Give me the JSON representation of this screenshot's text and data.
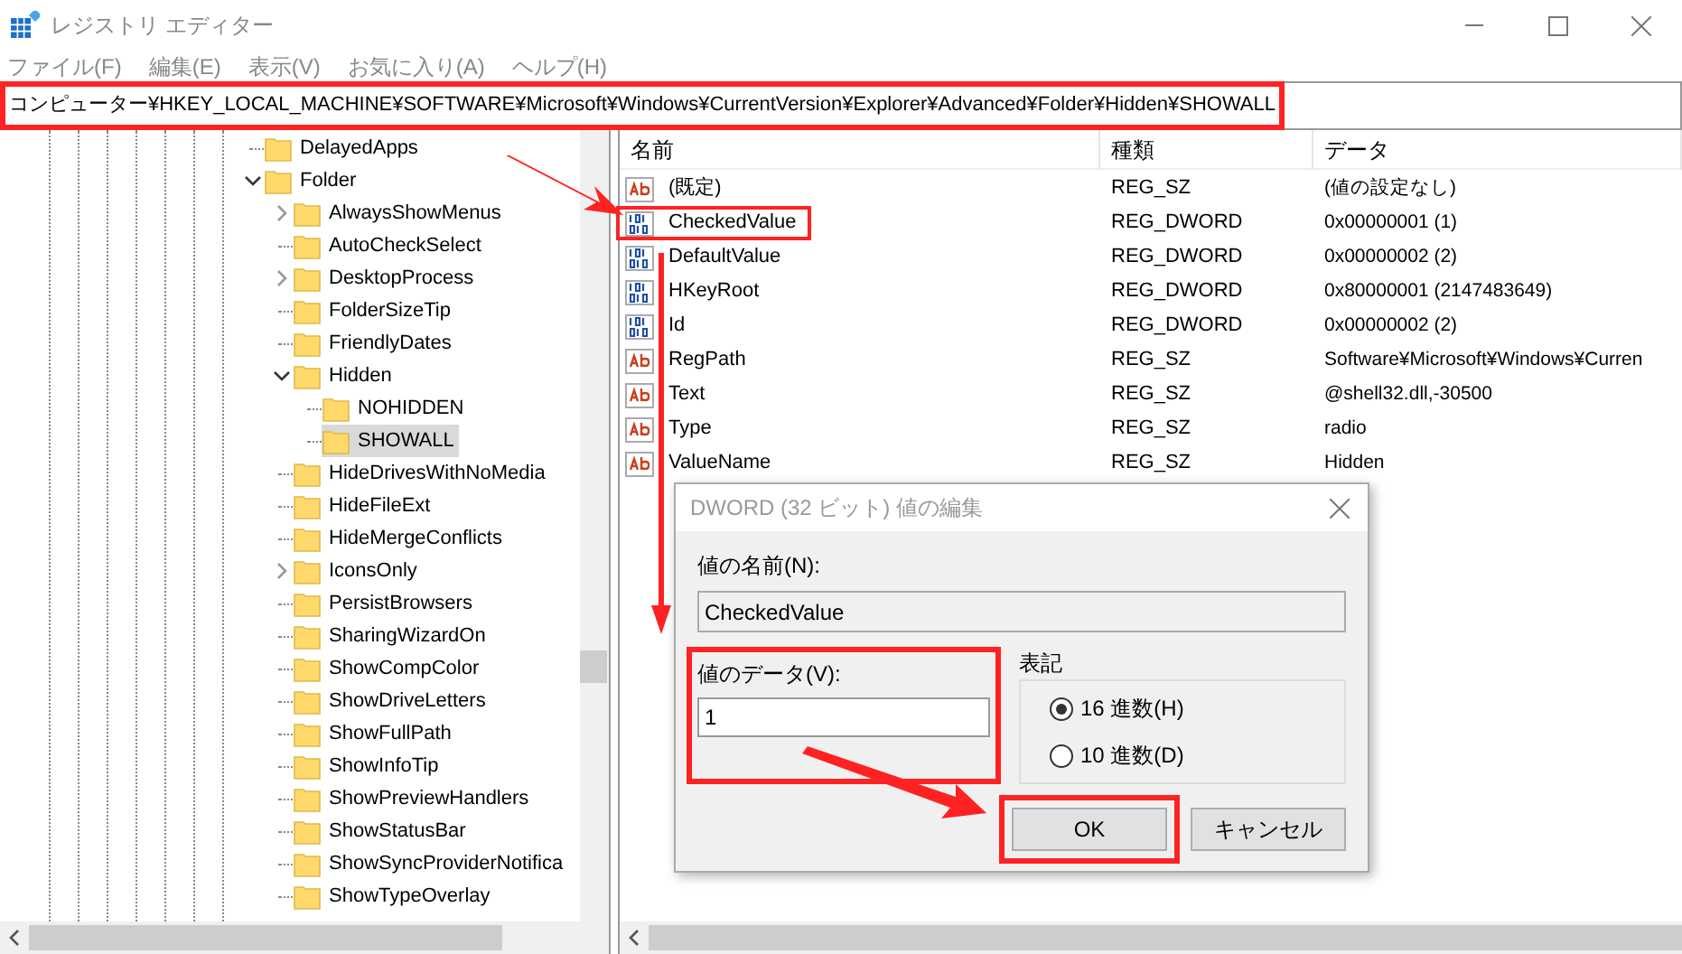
{
  "window": {
    "title": "レジストリ エディター"
  },
  "menu": [
    "ファイル(F)",
    "編集(E)",
    "表示(V)",
    "お気に入り(A)",
    "ヘルプ(H)"
  ],
  "address": "コンピューター¥HKEY_LOCAL_MACHINE¥SOFTWARE¥Microsoft¥Windows¥CurrentVersion¥Explorer¥Advanced¥Folder¥Hidden¥SHOWALL",
  "tree": [
    {
      "label": "DelayedApps",
      "kind": "leaf",
      "selected": false
    },
    {
      "label": "Folder",
      "kind": "node",
      "expanded": true,
      "selected": false,
      "children": [
        {
          "label": "AlwaysShowMenus",
          "kind": "node",
          "expanded": false,
          "selected": false
        },
        {
          "label": "AutoCheckSelect",
          "kind": "leaf",
          "selected": false
        },
        {
          "label": "DesktopProcess",
          "kind": "node",
          "expanded": false,
          "selected": false
        },
        {
          "label": "FolderSizeTip",
          "kind": "leaf",
          "selected": false
        },
        {
          "label": "FriendlyDates",
          "kind": "leaf",
          "selected": false
        },
        {
          "label": "Hidden",
          "kind": "node",
          "expanded": true,
          "selected": false,
          "children": [
            {
              "label": "NOHIDDEN",
              "kind": "leaf",
              "selected": false
            },
            {
              "label": "SHOWALL",
              "kind": "leaf",
              "selected": true
            }
          ]
        },
        {
          "label": "HideDrivesWithNoMedia",
          "kind": "leaf",
          "selected": false
        },
        {
          "label": "HideFileExt",
          "kind": "leaf",
          "selected": false
        },
        {
          "label": "HideMergeConflicts",
          "kind": "leaf",
          "selected": false
        },
        {
          "label": "IconsOnly",
          "kind": "node",
          "expanded": false,
          "selected": false
        },
        {
          "label": "PersistBrowsers",
          "kind": "leaf",
          "selected": false
        },
        {
          "label": "SharingWizardOn",
          "kind": "leaf",
          "selected": false
        },
        {
          "label": "ShowCompColor",
          "kind": "leaf",
          "selected": false
        },
        {
          "label": "ShowDriveLetters",
          "kind": "leaf",
          "selected": false
        },
        {
          "label": "ShowFullPath",
          "kind": "leaf",
          "selected": false
        },
        {
          "label": "ShowInfoTip",
          "kind": "leaf",
          "selected": false
        },
        {
          "label": "ShowPreviewHandlers",
          "kind": "leaf",
          "selected": false
        },
        {
          "label": "ShowStatusBar",
          "kind": "leaf",
          "selected": false
        },
        {
          "label": "ShowSyncProviderNotifica",
          "kind": "leaf",
          "selected": false
        },
        {
          "label": "ShowTypeOverlay",
          "kind": "leaf",
          "selected": false
        }
      ]
    }
  ],
  "table": {
    "columns": [
      "名前",
      "種類",
      "データ"
    ],
    "rows": [
      {
        "kind": "string",
        "name": "(既定)",
        "type": "REG_SZ",
        "data": "(値の設定なし)"
      },
      {
        "kind": "binary",
        "name": "CheckedValue",
        "type": "REG_DWORD",
        "data": "0x00000001 (1)"
      },
      {
        "kind": "binary",
        "name": "DefaultValue",
        "type": "REG_DWORD",
        "data": "0x00000002 (2)"
      },
      {
        "kind": "binary",
        "name": "HKeyRoot",
        "type": "REG_DWORD",
        "data": "0x80000001 (2147483649)"
      },
      {
        "kind": "binary",
        "name": "Id",
        "type": "REG_DWORD",
        "data": "0x00000002 (2)"
      },
      {
        "kind": "string",
        "name": "RegPath",
        "type": "REG_SZ",
        "data": "Software¥Microsoft¥Windows¥Curren"
      },
      {
        "kind": "string",
        "name": "Text",
        "type": "REG_SZ",
        "data": "@shell32.dll,-30500"
      },
      {
        "kind": "string",
        "name": "Type",
        "type": "REG_SZ",
        "data": "radio"
      },
      {
        "kind": "string",
        "name": "ValueName",
        "type": "REG_SZ",
        "data": "Hidden"
      }
    ]
  },
  "dialog": {
    "title": "DWORD (32 ビット) 値の編集",
    "name_label": "値の名前(N):",
    "name_value": "CheckedValue",
    "data_label": "値のデータ(V):",
    "data_value": "1",
    "base_label": "表記",
    "bases": [
      {
        "label": "16 進数(H)",
        "selected": true
      },
      {
        "label": "10 進数(D)",
        "selected": false
      }
    ],
    "buttons": [
      "OK",
      "キャンセル"
    ]
  }
}
